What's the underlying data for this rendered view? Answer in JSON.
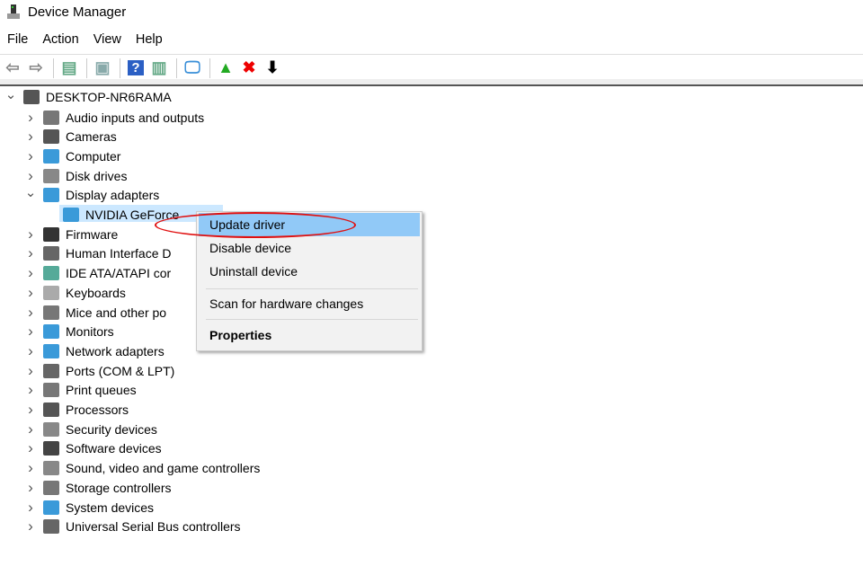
{
  "window": {
    "title": "Device Manager"
  },
  "menu": [
    "File",
    "Action",
    "View",
    "Help"
  ],
  "toolbar": [
    {
      "name": "back-icon",
      "glyph": "⇦",
      "color": "#888"
    },
    {
      "name": "forward-icon",
      "glyph": "⇨",
      "color": "#888"
    },
    {
      "sep": true
    },
    {
      "name": "show-hide-console-tree-icon",
      "glyph": "▤",
      "color": "#6a8"
    },
    {
      "sep": true
    },
    {
      "name": "properties-icon",
      "glyph": "▣",
      "color": "#8aa"
    },
    {
      "sep": true
    },
    {
      "name": "help-icon",
      "glyph": "?",
      "color": "#fff",
      "bg": "#2b5fc4"
    },
    {
      "name": "show-action-pane-icon",
      "glyph": "▥",
      "color": "#6a8"
    },
    {
      "sep": true
    },
    {
      "name": "scan-hardware-icon",
      "glyph": "🖵",
      "color": "#3a8fd8"
    },
    {
      "sep": true
    },
    {
      "name": "update-driver-icon",
      "glyph": "▲",
      "color": "#2a2"
    },
    {
      "name": "uninstall-icon",
      "glyph": "✖",
      "color": "#e00"
    },
    {
      "name": "disable-device-icon",
      "glyph": "⬇",
      "color": "#000"
    }
  ],
  "tree": {
    "root": "DESKTOP-NR6RAMA",
    "items": [
      {
        "label": "Audio inputs and outputs",
        "color": "#777"
      },
      {
        "label": "Cameras",
        "color": "#555"
      },
      {
        "label": "Computer",
        "color": "#3a9ad9"
      },
      {
        "label": "Disk drives",
        "color": "#888"
      },
      {
        "label": "Display adapters",
        "color": "#3a9ad9",
        "expanded": true,
        "children": [
          "NVIDIA GeForce"
        ]
      },
      {
        "label": "Firmware",
        "color": "#333"
      },
      {
        "label": "Human Interface D",
        "color": "#666"
      },
      {
        "label": "IDE ATA/ATAPI cor",
        "color": "#5a9"
      },
      {
        "label": "Keyboards",
        "color": "#aaa"
      },
      {
        "label": "Mice and other po",
        "color": "#777"
      },
      {
        "label": "Monitors",
        "color": "#3a9ad9"
      },
      {
        "label": "Network adapters",
        "color": "#3a9ad9"
      },
      {
        "label": "Ports (COM & LPT)",
        "color": "#666"
      },
      {
        "label": "Print queues",
        "color": "#777"
      },
      {
        "label": "Processors",
        "color": "#555"
      },
      {
        "label": "Security devices",
        "color": "#888"
      },
      {
        "label": "Software devices",
        "color": "#444"
      },
      {
        "label": "Sound, video and game controllers",
        "color": "#888"
      },
      {
        "label": "Storage controllers",
        "color": "#777"
      },
      {
        "label": "System devices",
        "color": "#3a9ad9"
      },
      {
        "label": "Universal Serial Bus controllers",
        "color": "#666"
      }
    ]
  },
  "context_menu": {
    "items": [
      "Update driver",
      "Disable device",
      "Uninstall device",
      "Scan for hardware changes",
      "Properties"
    ],
    "highlighted": "Update driver",
    "highlight_color": "#91c9f7",
    "annotation_color": "#e01010"
  }
}
